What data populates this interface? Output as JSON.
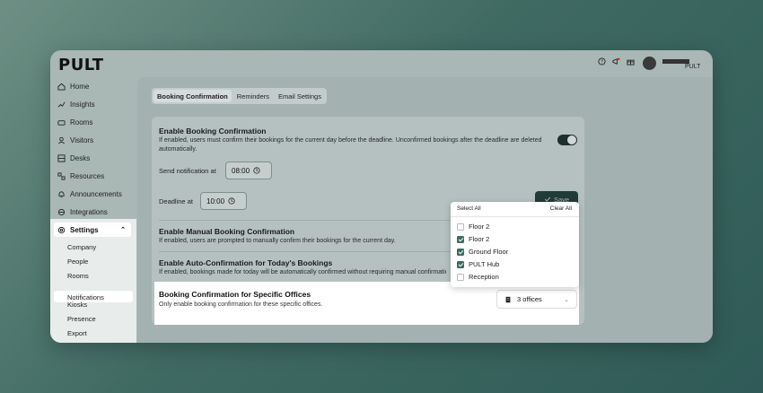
{
  "app": {
    "logo": "PULT",
    "user_sub": "PULT"
  },
  "sidebar": {
    "items": [
      {
        "label": "Home",
        "icon": "home-icon"
      },
      {
        "label": "Insights",
        "icon": "insights-icon"
      },
      {
        "label": "Rooms",
        "icon": "rooms-icon"
      },
      {
        "label": "Visitors",
        "icon": "visitors-icon"
      },
      {
        "label": "Desks",
        "icon": "desks-icon"
      },
      {
        "label": "Resources",
        "icon": "resources-icon"
      },
      {
        "label": "Announcements",
        "icon": "bell-icon"
      },
      {
        "label": "Integrations",
        "icon": "integrations-icon"
      }
    ],
    "settings_label": "Settings",
    "sub_items": [
      "Company",
      "People",
      "Rooms",
      "Notifications",
      "Kiosks",
      "Presence",
      "Export"
    ],
    "active_sub": "Notifications"
  },
  "tabs": [
    "Booking Confirmation",
    "Reminders",
    "Email Settings"
  ],
  "sections": {
    "enable_booking": {
      "title": "Enable Booking Confirmation",
      "desc": "If enabled, users must confirm their bookings for the current day before the deadline. Unconfirmed bookings after the deadline are deleted automatically."
    },
    "send_notification_label": "Send notification at",
    "send_notification_value": "08:00",
    "deadline_label": "Deadline at",
    "deadline_value": "10:00",
    "save_label": "Save",
    "manual": {
      "title": "Enable Manual Booking Confirmation",
      "desc": "If enabled, users are prompted to manually confirm their bookings for the current day."
    },
    "auto": {
      "title": "Enable Auto-Confirmation for Today's Bookings",
      "desc": "If enabled, bookings made for today will be automatically confirmed without requiring manual confirmation."
    },
    "specific": {
      "title": "Booking Confirmation for Specific Offices",
      "desc": "Only enable booking confirmation for these specific offices.",
      "select_value": "3 offices"
    }
  },
  "dropdown": {
    "select_all": "Select All",
    "clear_all": "Clear All",
    "options": [
      {
        "label": "Floor 2",
        "checked": false
      },
      {
        "label": "Floor 2",
        "checked": true
      },
      {
        "label": "Ground Floor",
        "checked": true
      },
      {
        "label": "PULT Hub",
        "checked": true
      },
      {
        "label": "Reception",
        "checked": false
      }
    ]
  },
  "colors": {
    "accent": "#3d6b62",
    "dark": "#233b37"
  }
}
